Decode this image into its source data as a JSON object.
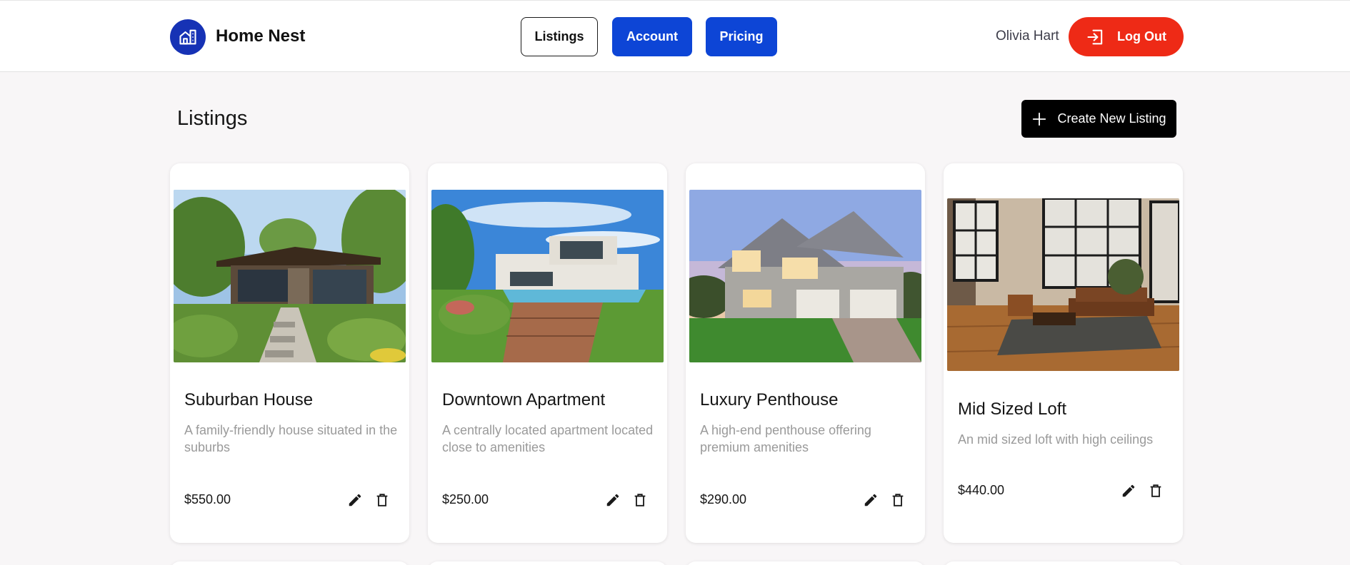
{
  "header": {
    "brand": "Home Nest",
    "logo_icon": "house-building-icon",
    "nav": [
      {
        "label": "Listings"
      },
      {
        "label": "Account"
      },
      {
        "label": "Pricing"
      }
    ],
    "user_name": "Olivia Hart",
    "logout_label": "Log Out",
    "logout_icon": "sign-in-arrow-icon"
  },
  "main": {
    "title": "Listings",
    "create_label": "Create New Listing",
    "create_icon": "plus-icon"
  },
  "listings": [
    {
      "title": "Suburban House",
      "description": "A family-friendly house situated in the suburbs",
      "price": "$550.00",
      "image": "modern-house-garden-photo"
    },
    {
      "title": "Downtown Apartment",
      "description": "A centrally located apartment located close to amenities",
      "price": "$250.00",
      "image": "modern-house-pool-photo"
    },
    {
      "title": "Luxury Penthouse",
      "description": "A high-end penthouse offering premium amenities",
      "price": "$290.00",
      "image": "suburban-house-dusk-photo"
    },
    {
      "title": "Mid Sized Loft",
      "description": "An mid sized loft with high ceilings",
      "price": "$440.00",
      "image": "loft-interior-photo"
    }
  ],
  "colors": {
    "primary": "#0d45d6",
    "logo": "#1632b5",
    "danger": "#ee2a16",
    "background": "#f8f6f7"
  }
}
